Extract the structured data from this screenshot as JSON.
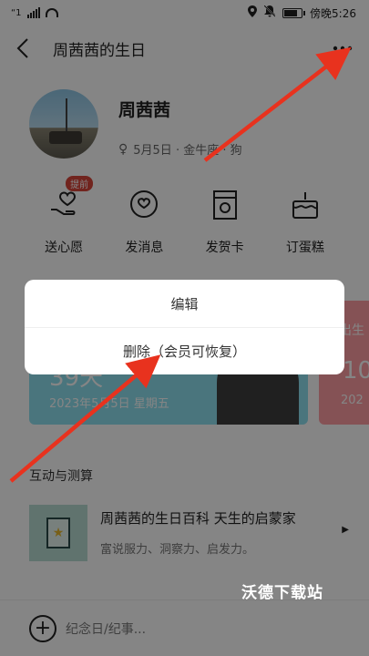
{
  "status_bar": {
    "signal_text": "“1",
    "time": "傍晚5:26"
  },
  "nav": {
    "title": "周茜茜的生日",
    "back_icon": "chevron-left-icon",
    "more_icon": "more-dots-icon"
  },
  "profile": {
    "name": "周茜茜",
    "gender_icon": "female-icon",
    "meta": "5月5日 · 金牛座 · 狗"
  },
  "actions": [
    {
      "label": "送心愿",
      "icon": "heart-hand-icon",
      "badge": "提前"
    },
    {
      "label": "发消息",
      "icon": "message-heart-icon"
    },
    {
      "label": "发贺卡",
      "icon": "greeting-card-icon"
    },
    {
      "label": "订蛋糕",
      "icon": "cake-icon"
    }
  ],
  "cards": {
    "blue": {
      "big_text": "39天",
      "date": "2023年5月5日  星期五"
    },
    "pink": {
      "top_text": "出生",
      "big_text": "10",
      "date": "202"
    }
  },
  "section": {
    "title": "互动与测算"
  },
  "article": {
    "title": "周茜茜的生日百科  天生的启蒙家",
    "subtitle": "富说服力、洞察力、启发力。",
    "thumb_icon": "star-card-icon"
  },
  "bottom_bar": {
    "placeholder": "纪念日/纪事...",
    "add_icon": "plus-circle-icon"
  },
  "menu": {
    "items": [
      {
        "label": "编辑"
      },
      {
        "label": "删除（会员可恢复）"
      }
    ]
  },
  "watermark": "沃德下载站",
  "colors": {
    "annotation_arrow": "#e8321e",
    "overlay": "rgba(0,0,0,0.48)",
    "card_blue": "#8fe0f0",
    "card_pink": "#ff9da4",
    "badge": "#d9463a"
  }
}
